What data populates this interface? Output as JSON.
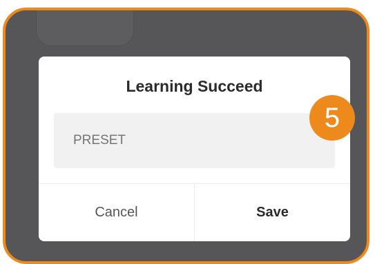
{
  "background": {
    "tile_glyph": "+"
  },
  "dialog": {
    "title": "Learning Succeed",
    "input": {
      "placeholder": "PRESET",
      "value": ""
    },
    "cancel_label": "Cancel",
    "save_label": "Save"
  },
  "annotation": {
    "step_number": "5"
  },
  "colors": {
    "accent": "#ee8a1c",
    "backdrop": "#565658",
    "dialog_bg": "#ffffff",
    "input_bg": "#f1f1f1"
  }
}
